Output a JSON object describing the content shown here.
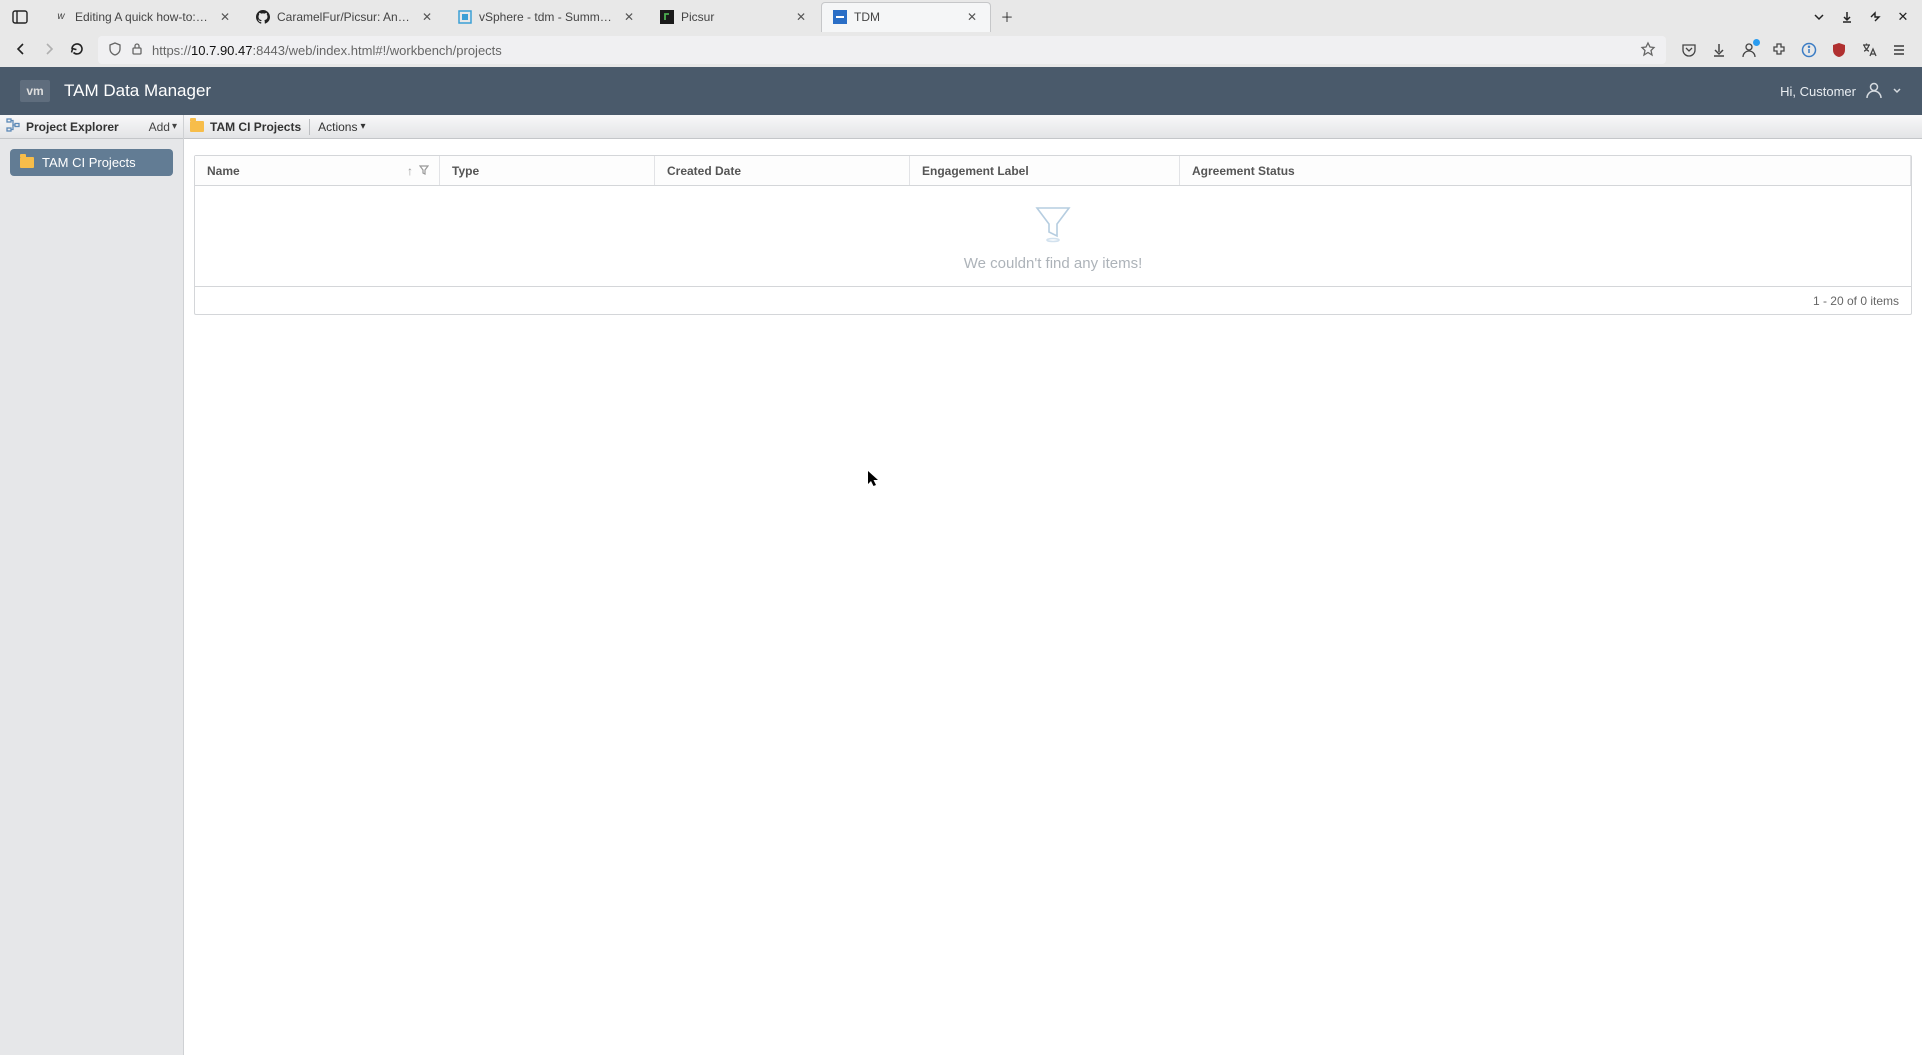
{
  "browser": {
    "tabs": [
      {
        "label": "Editing A quick how-to: Depl"
      },
      {
        "label": "CaramelFur/Picsur: An easy"
      },
      {
        "label": "vSphere - tdm - Summary"
      },
      {
        "label": "Picsur"
      },
      {
        "label": "TDM"
      }
    ],
    "url_prefix": "https://",
    "url_host": "10.7.90.47",
    "url_path": ":8443/web/index.html#!/workbench/projects"
  },
  "app": {
    "logo_text": "vm",
    "title": "TAM Data Manager",
    "user_greeting": "Hi, Customer"
  },
  "sidebar": {
    "title": "Project Explorer",
    "add_label": "Add",
    "items": [
      {
        "label": "TAM CI Projects"
      }
    ]
  },
  "content": {
    "crumb": "TAM CI Projects",
    "actions_label": "Actions",
    "columns": {
      "name": "Name",
      "type": "Type",
      "created": "Created Date",
      "engagement": "Engagement Label",
      "agreement": "Agreement Status"
    },
    "empty_message": "We couldn't find any items!",
    "footer_text": "1 - 20 of 0 items"
  }
}
